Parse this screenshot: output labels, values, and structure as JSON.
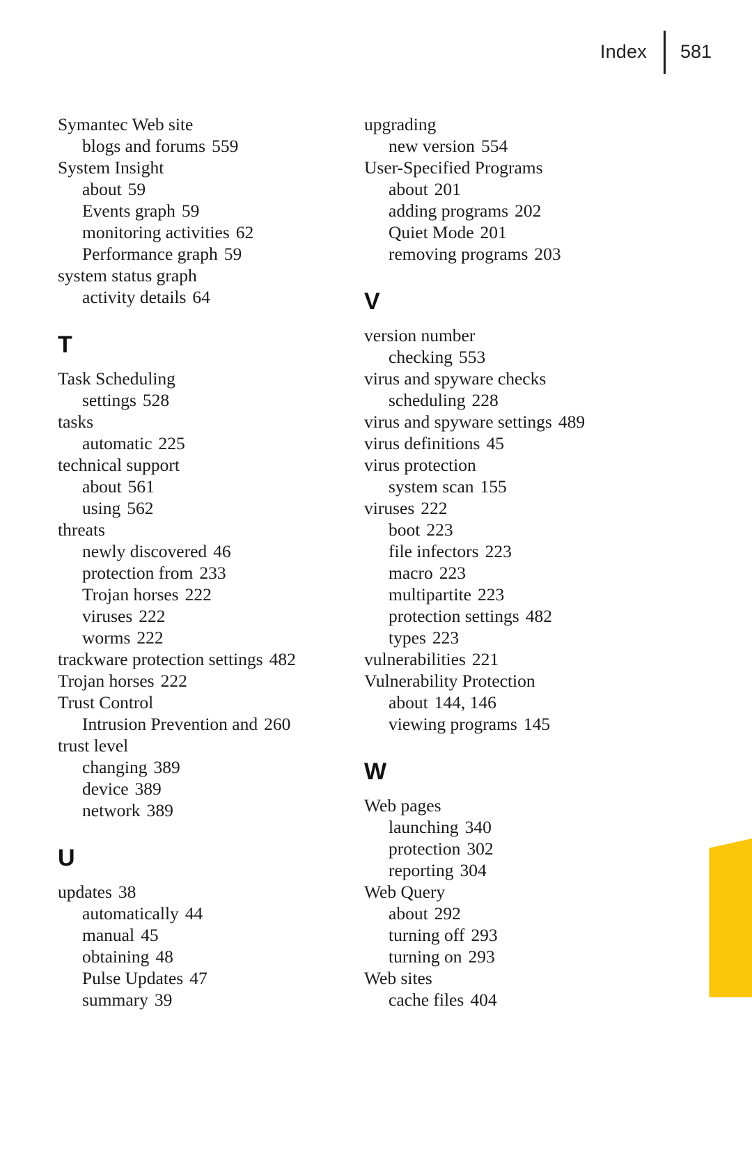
{
  "running_head": {
    "label": "Index",
    "folio": "581"
  },
  "accent_color": "#fcc60a",
  "columns": [
    {
      "name": "left",
      "blocks": [
        {
          "type": "entries",
          "entries": [
            {
              "level": "main",
              "text": "Symantec Web site",
              "page": ""
            },
            {
              "level": "sub",
              "text": "blogs and forums",
              "page": "559"
            },
            {
              "level": "main",
              "text": "System Insight",
              "page": ""
            },
            {
              "level": "sub",
              "text": "about",
              "page": "59"
            },
            {
              "level": "sub",
              "text": "Events graph",
              "page": "59"
            },
            {
              "level": "sub",
              "text": "monitoring activities",
              "page": "62"
            },
            {
              "level": "sub",
              "text": "Performance graph",
              "page": "59"
            },
            {
              "level": "main",
              "text": "system status graph",
              "page": ""
            },
            {
              "level": "sub",
              "text": "activity details",
              "page": "64"
            }
          ]
        },
        {
          "type": "letter",
          "letter": "T"
        },
        {
          "type": "entries",
          "entries": [
            {
              "level": "main",
              "text": "Task Scheduling",
              "page": ""
            },
            {
              "level": "sub",
              "text": "settings",
              "page": "528"
            },
            {
              "level": "main",
              "text": "tasks",
              "page": ""
            },
            {
              "level": "sub",
              "text": "automatic",
              "page": "225"
            },
            {
              "level": "main",
              "text": "technical support",
              "page": ""
            },
            {
              "level": "sub",
              "text": "about",
              "page": "561"
            },
            {
              "level": "sub",
              "text": "using",
              "page": "562"
            },
            {
              "level": "main",
              "text": "threats",
              "page": ""
            },
            {
              "level": "sub",
              "text": "newly discovered",
              "page": "46"
            },
            {
              "level": "sub",
              "text": "protection from",
              "page": "233"
            },
            {
              "level": "sub",
              "text": "Trojan horses",
              "page": "222"
            },
            {
              "level": "sub",
              "text": "viruses",
              "page": "222"
            },
            {
              "level": "sub",
              "text": "worms",
              "page": "222"
            },
            {
              "level": "main",
              "text": "trackware protection settings",
              "page": "482"
            },
            {
              "level": "main",
              "text": "Trojan horses",
              "page": "222"
            },
            {
              "level": "main",
              "text": "Trust Control",
              "page": ""
            },
            {
              "level": "sub",
              "text": "Intrusion Prevention and",
              "page": "260"
            },
            {
              "level": "main",
              "text": "trust level",
              "page": ""
            },
            {
              "level": "sub",
              "text": "changing",
              "page": "389"
            },
            {
              "level": "sub",
              "text": "device",
              "page": "389"
            },
            {
              "level": "sub",
              "text": "network",
              "page": "389"
            }
          ]
        },
        {
          "type": "letter",
          "letter": "U"
        },
        {
          "type": "entries",
          "entries": [
            {
              "level": "main",
              "text": "updates",
              "page": "38"
            },
            {
              "level": "sub",
              "text": "automatically",
              "page": "44"
            },
            {
              "level": "sub",
              "text": "manual",
              "page": "45"
            },
            {
              "level": "sub",
              "text": "obtaining",
              "page": "48"
            },
            {
              "level": "sub",
              "text": "Pulse Updates",
              "page": "47"
            },
            {
              "level": "sub",
              "text": "summary",
              "page": "39"
            }
          ]
        }
      ]
    },
    {
      "name": "right",
      "blocks": [
        {
          "type": "entries",
          "entries": [
            {
              "level": "main",
              "text": "upgrading",
              "page": ""
            },
            {
              "level": "sub",
              "text": "new version",
              "page": "554"
            },
            {
              "level": "main",
              "text": "User-Specified Programs",
              "page": ""
            },
            {
              "level": "sub",
              "text": "about",
              "page": "201"
            },
            {
              "level": "sub",
              "text": "adding programs",
              "page": "202"
            },
            {
              "level": "sub",
              "text": "Quiet Mode",
              "page": "201"
            },
            {
              "level": "sub",
              "text": "removing programs",
              "page": "203"
            }
          ]
        },
        {
          "type": "letter",
          "letter": "V"
        },
        {
          "type": "entries",
          "entries": [
            {
              "level": "main",
              "text": "version number",
              "page": ""
            },
            {
              "level": "sub",
              "text": "checking",
              "page": "553"
            },
            {
              "level": "main",
              "text": "virus and spyware checks",
              "page": ""
            },
            {
              "level": "sub",
              "text": "scheduling",
              "page": "228"
            },
            {
              "level": "main",
              "text": "virus and spyware settings",
              "page": "489"
            },
            {
              "level": "main",
              "text": "virus definitions",
              "page": "45"
            },
            {
              "level": "main",
              "text": "virus protection",
              "page": ""
            },
            {
              "level": "sub",
              "text": "system scan",
              "page": "155"
            },
            {
              "level": "main",
              "text": "viruses",
              "page": "222"
            },
            {
              "level": "sub",
              "text": "boot",
              "page": "223"
            },
            {
              "level": "sub",
              "text": "file infectors",
              "page": "223"
            },
            {
              "level": "sub",
              "text": "macro",
              "page": "223"
            },
            {
              "level": "sub",
              "text": "multipartite",
              "page": "223"
            },
            {
              "level": "sub",
              "text": "protection settings",
              "page": "482"
            },
            {
              "level": "sub",
              "text": "types",
              "page": "223"
            },
            {
              "level": "main",
              "text": "vulnerabilities",
              "page": "221"
            },
            {
              "level": "main",
              "text": "Vulnerability Protection",
              "page": ""
            },
            {
              "level": "sub",
              "text": "about",
              "page": "144, 146"
            },
            {
              "level": "sub",
              "text": "viewing programs",
              "page": "145"
            }
          ]
        },
        {
          "type": "letter",
          "letter": "W"
        },
        {
          "type": "entries",
          "entries": [
            {
              "level": "main",
              "text": "Web pages",
              "page": ""
            },
            {
              "level": "sub",
              "text": "launching",
              "page": "340"
            },
            {
              "level": "sub",
              "text": "protection",
              "page": "302"
            },
            {
              "level": "sub",
              "text": "reporting",
              "page": "304"
            },
            {
              "level": "main",
              "text": "Web Query",
              "page": ""
            },
            {
              "level": "sub",
              "text": "about",
              "page": "292"
            },
            {
              "level": "sub",
              "text": "turning off",
              "page": "293"
            },
            {
              "level": "sub",
              "text": "turning on",
              "page": "293"
            },
            {
              "level": "main",
              "text": "Web sites",
              "page": ""
            },
            {
              "level": "sub",
              "text": "cache files",
              "page": "404"
            }
          ]
        }
      ]
    }
  ]
}
